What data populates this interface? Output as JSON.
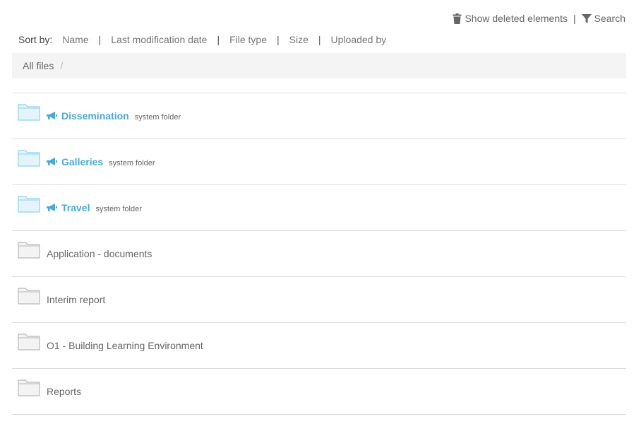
{
  "top_actions": {
    "show_deleted_label": "Show deleted elements",
    "separator": "|",
    "search_label": "Search",
    "trash_icon": "trash-icon",
    "filter_icon": "filter-icon"
  },
  "sort": {
    "label": "Sort by:",
    "separator": "|",
    "options": [
      "Name",
      "Last modification date",
      "File type",
      "Size",
      "Uploaded by"
    ]
  },
  "breadcrumb": {
    "root": "All files",
    "separator": "/"
  },
  "folders": [
    {
      "name": "Dissemination",
      "system": true,
      "tag": "system folder"
    },
    {
      "name": "Galleries",
      "system": true,
      "tag": "system folder"
    },
    {
      "name": "Travel",
      "system": true,
      "tag": "system folder"
    },
    {
      "name": "Application - documents",
      "system": false
    },
    {
      "name": "Interim report",
      "system": false
    },
    {
      "name": "O1 - Building Learning Environment",
      "system": false
    },
    {
      "name": "Reports",
      "system": false
    }
  ],
  "colors": {
    "system_folder_text": "#4aa8d8",
    "system_folder_fill": "#e3f4fc",
    "system_folder_stroke": "#8fd0ee",
    "regular_folder_fill": "#f3f3f3",
    "regular_folder_stroke": "#b9b9b9"
  }
}
